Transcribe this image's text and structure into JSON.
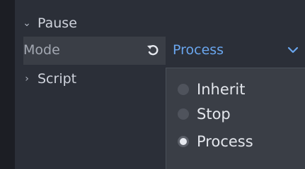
{
  "inspector": {
    "pause_section": {
      "label": "Pause",
      "expanded": true
    },
    "mode_property": {
      "label": "Mode",
      "value": "Process",
      "revert_icon": "revert-icon",
      "dropdown_icon": "chevron-down-icon"
    },
    "script_section": {
      "label": "Script",
      "expanded": false
    }
  },
  "mode_popup": {
    "options": [
      {
        "label": "Inherit",
        "selected": false
      },
      {
        "label": "Stop",
        "selected": false
      },
      {
        "label": "Process",
        "selected": true
      }
    ]
  },
  "colors": {
    "accent_value": "#6aa6ee",
    "panel_bg": "#2b2f38",
    "popup_bg": "#3a3e46"
  }
}
